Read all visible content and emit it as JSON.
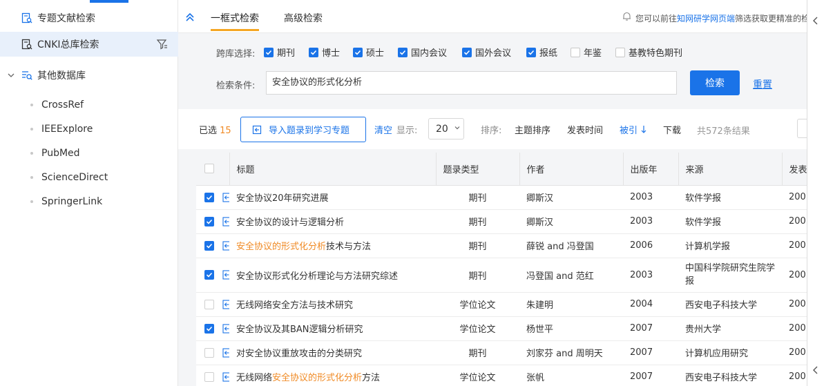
{
  "sidebar": {
    "items": [
      {
        "label": "专题文献检索"
      },
      {
        "label": "CNKI总库检索"
      },
      {
        "label": "其他数据库"
      }
    ],
    "databases": [
      "CrossRef",
      "IEEExplore",
      "PubMed",
      "ScienceDirect",
      "SpringerLink"
    ]
  },
  "tabs": {
    "simple": "一框式检索",
    "advanced": "高级检索"
  },
  "notice": {
    "prefix": "您可以前往",
    "link": "知网研学网页端",
    "suffix": "筛选获取更精准的检"
  },
  "search": {
    "cross_label": "跨库选择:",
    "options": [
      {
        "label": "期刊",
        "checked": true
      },
      {
        "label": "博士",
        "checked": true
      },
      {
        "label": "硕士",
        "checked": true
      },
      {
        "label": "国内会议",
        "checked": true
      },
      {
        "label": "国外会议",
        "checked": true
      },
      {
        "label": "报纸",
        "checked": true
      },
      {
        "label": "年鉴",
        "checked": false
      },
      {
        "label": "基教特色期刊",
        "checked": false
      }
    ],
    "cond_label": "检索条件:",
    "query": "安全协议的形式化分析",
    "search_button": "检索",
    "reset_link": "重置"
  },
  "toolbar": {
    "selected_prefix": "已选",
    "selected_count": "15",
    "import_button": "导入题录到学习专题",
    "clear": "清空",
    "show_label": "显示:",
    "page_size": "20",
    "sort_label": "排序:",
    "sort_subject": "主题排序",
    "sort_date": "发表时间",
    "sort_cited": "被引",
    "sort_download": "下载",
    "total": "共572条结果"
  },
  "table": {
    "headers": [
      "标题",
      "题录类型",
      "作者",
      "出版年",
      "来源",
      "发表"
    ],
    "rows": [
      {
        "checked": true,
        "title_pre": "安全协议20年研究进展",
        "title_hl": "",
        "title_post": "",
        "type": "期刊",
        "author": "卿斯汉",
        "year": "2003",
        "source": "软件学报",
        "pub": "200"
      },
      {
        "checked": true,
        "title_pre": "安全协议的设计与逻辑分析",
        "title_hl": "",
        "title_post": "",
        "type": "期刊",
        "author": "卿斯汉",
        "year": "2003",
        "source": "软件学报",
        "pub": "200"
      },
      {
        "checked": true,
        "title_pre": "",
        "title_hl": "安全协议的形式化分析",
        "title_post": "技术与方法",
        "type": "期刊",
        "author": "薛锐 and 冯登国",
        "year": "2006",
        "source": "计算机学报",
        "pub": "200"
      },
      {
        "checked": true,
        "title_pre": "安全协议形式化分析理论与方法研究综述",
        "title_hl": "",
        "title_post": "",
        "type": "期刊",
        "author": "冯登国 and 范红",
        "year": "2003",
        "source": "中国科学院研究生院学报",
        "pub": "200"
      },
      {
        "checked": false,
        "title_pre": "无线网络安全方法与技术研究",
        "title_hl": "",
        "title_post": "",
        "type": "学位论文",
        "author": "朱建明",
        "year": "2004",
        "source": "西安电子科技大学",
        "pub": "200"
      },
      {
        "checked": true,
        "title_pre": "安全协议及其BAN逻辑分析研究",
        "title_hl": "",
        "title_post": "",
        "type": "学位论文",
        "author": "杨世平",
        "year": "2007",
        "source": "贵州大学",
        "pub": "200"
      },
      {
        "checked": false,
        "title_pre": "对安全协议重放攻击的分类研究",
        "title_hl": "",
        "title_post": "",
        "type": "期刊",
        "author": "刘家芬 and 周明天",
        "year": "2007",
        "source": "计算机应用研究",
        "pub": "200"
      },
      {
        "checked": false,
        "title_pre": "无线网络",
        "title_hl": "安全协议的形式化分析",
        "title_post": "方法",
        "type": "学位论文",
        "author": "张帆",
        "year": "2007",
        "source": "西安电子科技大学",
        "pub": "200"
      }
    ]
  },
  "colors": {
    "accent": "#1a73e8",
    "highlight": "#f08a24",
    "tab_underline": "#f5a623"
  }
}
